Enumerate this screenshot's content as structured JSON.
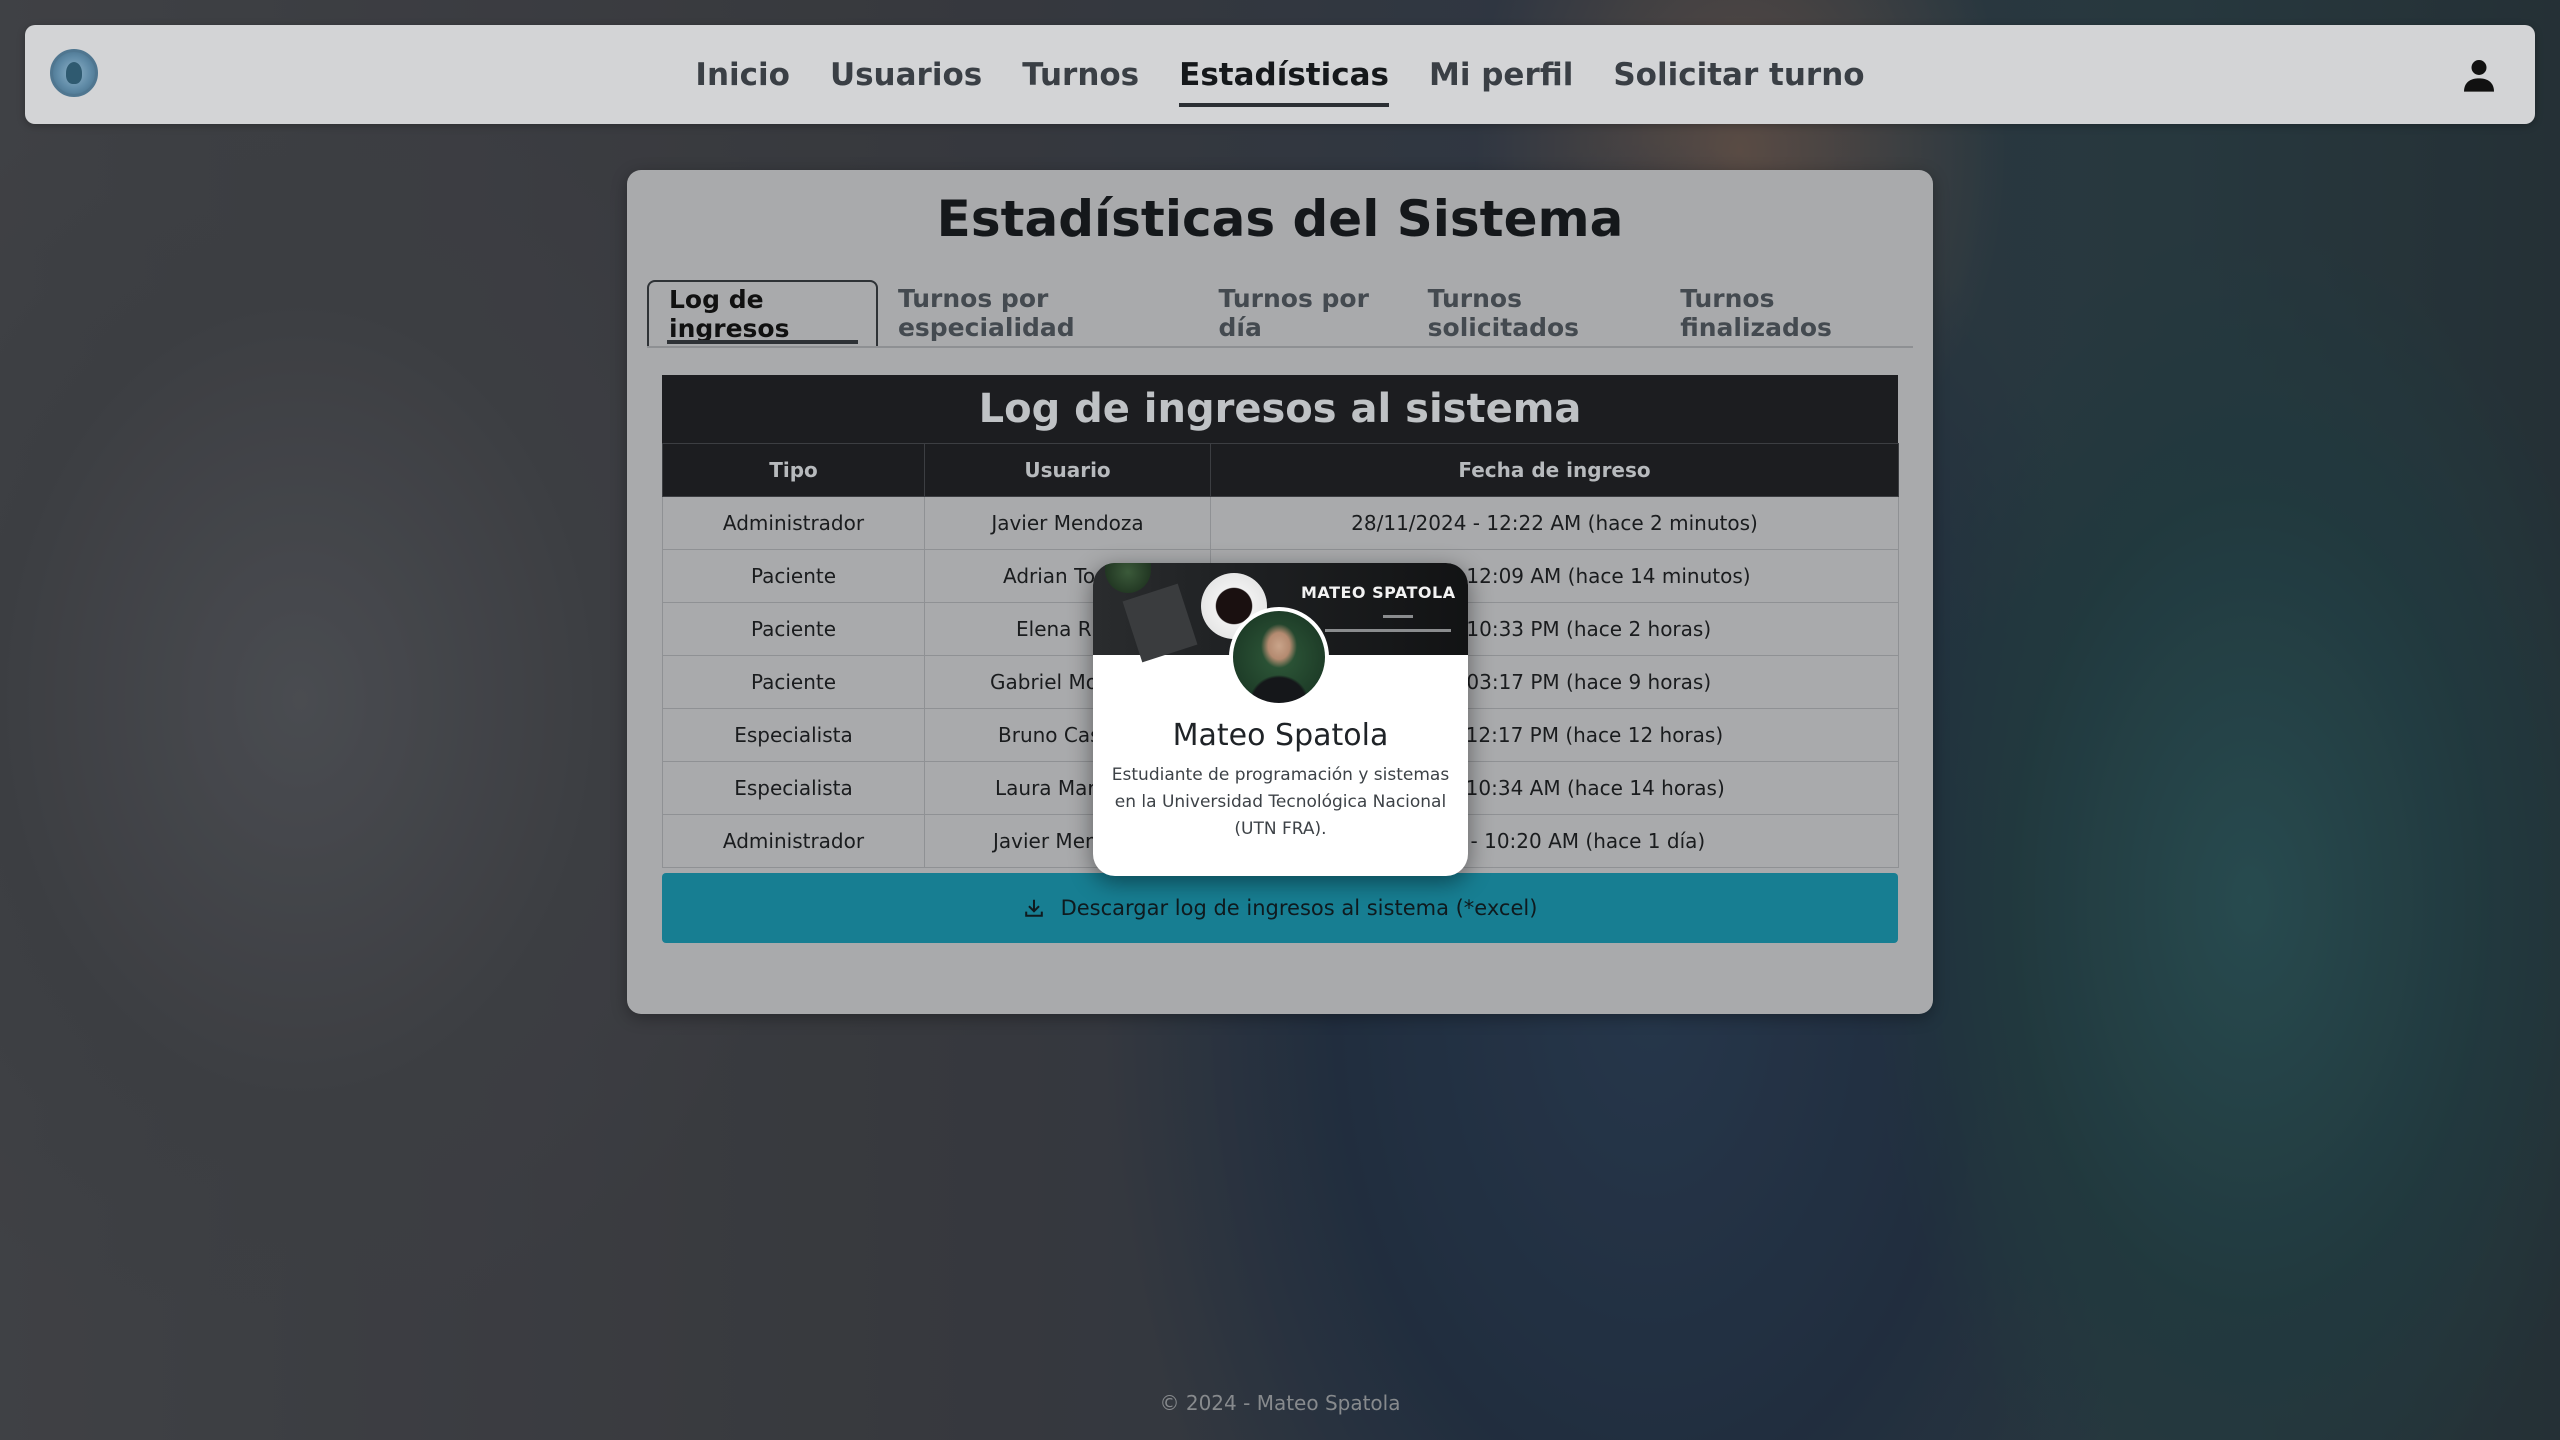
{
  "nav": {
    "items": [
      {
        "label": "Inicio"
      },
      {
        "label": "Usuarios"
      },
      {
        "label": "Turnos"
      },
      {
        "label": "Estadísticas"
      },
      {
        "label": "Mi perfil"
      },
      {
        "label": "Solicitar turno"
      }
    ],
    "active_index": 3,
    "logo_icon": "caduceus-logo-icon",
    "user_icon": "person-icon"
  },
  "stats": {
    "title": "Estadísticas del Sistema",
    "tabs": [
      {
        "label": "Log de ingresos"
      },
      {
        "label": "Turnos por especialidad"
      },
      {
        "label": "Turnos por día"
      },
      {
        "label": "Turnos solicitados"
      },
      {
        "label": "Turnos finalizados"
      }
    ],
    "active_tab": 0
  },
  "log": {
    "title": "Log de ingresos al sistema",
    "headers": [
      "Tipo",
      "Usuario",
      "Fecha de ingreso"
    ],
    "rows": [
      {
        "tipo": "Administrador",
        "usuario": "Javier Mendoza",
        "fecha": "28/11/2024 - 12:22 AM (hace 2 minutos)"
      },
      {
        "tipo": "Paciente",
        "usuario": "Adrian Tor",
        "fecha": "24 - 12:09 AM (hace 14 minutos)"
      },
      {
        "tipo": "Paciente",
        "usuario": "Elena R",
        "fecha": "24 - 10:33 PM (hace 2 horas)"
      },
      {
        "tipo": "Paciente",
        "usuario": "Gabriel Mo",
        "fecha": "24 - 03:17 PM (hace 9 horas)"
      },
      {
        "tipo": "Especialista",
        "usuario": "Bruno Cas",
        "fecha": "4 - 12:17 PM (hace 12 horas)"
      },
      {
        "tipo": "Especialista",
        "usuario": "Laura Mar",
        "fecha": "4 - 10:34 AM (hace 14 horas)"
      },
      {
        "tipo": "Administrador",
        "usuario": "Javier Men",
        "fecha": "024 - 10:20 AM (hace 1 día)"
      }
    ],
    "download_label": "Descargar log de ingresos al sistema (*excel)",
    "download_icon": "download-icon"
  },
  "profile_popup": {
    "banner_text": "MATEO SPATOLA",
    "name": "Mateo Spatola",
    "description": "Estudiante de programación y sistemas en la Universidad Tecnológica Nacional (UTN FRA)."
  },
  "footer": {
    "text": "© 2024 - Mateo Spatola"
  },
  "colors": {
    "navbar_bg": "#d3d4d6",
    "card_bg": "#a9aaac",
    "table_header_bg": "#1c1d20",
    "download_button_bg": "#177e92"
  }
}
